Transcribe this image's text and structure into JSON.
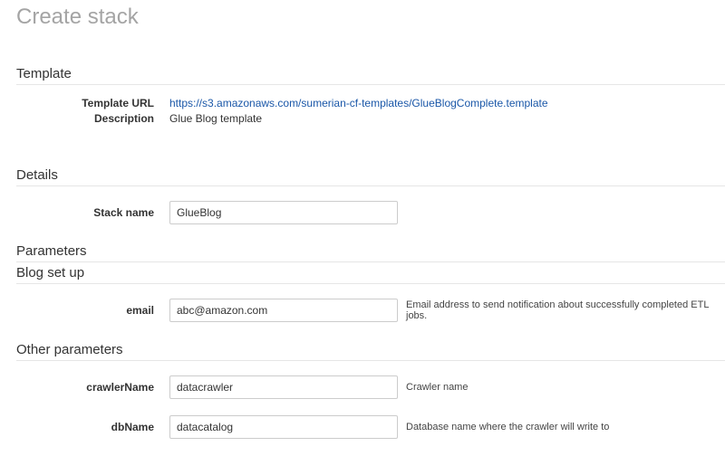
{
  "page": {
    "title": "Create stack"
  },
  "template_section": {
    "heading": "Template",
    "url_label": "Template URL",
    "url_value": "https://s3.amazonaws.com/sumerian-cf-templates/GlueBlogComplete.template",
    "description_label": "Description",
    "description_value": "Glue Blog template"
  },
  "details_section": {
    "heading": "Details",
    "stack_name_label": "Stack name",
    "stack_name_value": "GlueBlog"
  },
  "parameters_section": {
    "heading": "Parameters",
    "blog_setup": {
      "heading": "Blog set up",
      "email_label": "email",
      "email_value": "abc@amazon.com",
      "email_help": "Email address to send notification about successfully completed ETL jobs."
    },
    "other": {
      "heading": "Other parameters",
      "crawler_label": "crawlerName",
      "crawler_value": "datacrawler",
      "crawler_help": "Crawler name",
      "db_label": "dbName",
      "db_value": "datacatalog",
      "db_help": "Database name where the crawler will write to"
    }
  }
}
